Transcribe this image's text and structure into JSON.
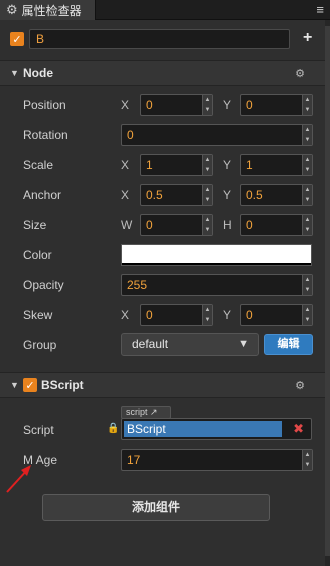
{
  "tab": {
    "title": "属性检查器",
    "gear_icon": "⚙",
    "menu_icon": "≡"
  },
  "node_name": {
    "value": "B",
    "add_icon": "+"
  },
  "node_section": {
    "title": "Node",
    "props": {
      "position": {
        "label": "Position",
        "x_label": "X",
        "x": "0",
        "y_label": "Y",
        "y": "0"
      },
      "rotation": {
        "label": "Rotation",
        "value": "0"
      },
      "scale": {
        "label": "Scale",
        "x_label": "X",
        "x": "1",
        "y_label": "Y",
        "y": "1"
      },
      "anchor": {
        "label": "Anchor",
        "x_label": "X",
        "x": "0.5",
        "y_label": "Y",
        "y": "0.5"
      },
      "size": {
        "label": "Size",
        "w_label": "W",
        "w": "0",
        "h_label": "H",
        "h": "0"
      },
      "color": {
        "label": "Color",
        "value": "#ffffff"
      },
      "opacity": {
        "label": "Opacity",
        "value": "255"
      },
      "skew": {
        "label": "Skew",
        "x_label": "X",
        "x": "0",
        "y_label": "Y",
        "y": "0"
      },
      "group": {
        "label": "Group",
        "selected": "default",
        "edit_button": "编辑"
      }
    }
  },
  "bscript_section": {
    "title": "BScript",
    "script": {
      "label": "Script",
      "tag": "script",
      "value": "BScript"
    },
    "m_age": {
      "label": "M Age",
      "value": "17"
    }
  },
  "add_component": "添加组件",
  "colors": {
    "accent": "#e9831e",
    "value_text": "#f2a33c",
    "link_blue": "#2f7bbf",
    "arrow_red": "#e02020"
  }
}
